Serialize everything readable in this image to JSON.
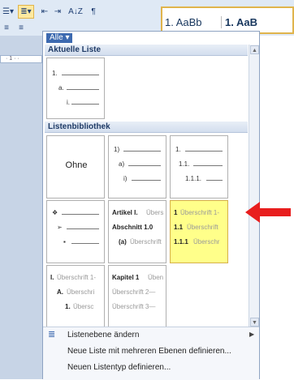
{
  "ribbon": {
    "btn_bullets": "☰▾",
    "btn_multilevel": "≣▾",
    "btn_outdent": "⇤",
    "btn_indent": "⇥",
    "btn_sort": "A↓Z",
    "btn_pilcrow": "¶",
    "btn_align_left": "≡",
    "btn_align_center": "≡",
    "style1": "1. AaBb",
    "style2": "1. AaB",
    "ruler_text": "· 1 · ·"
  },
  "panel": {
    "filter_label": "Alle ▾",
    "section_current": "Aktuelle Liste",
    "section_library": "Listenbibliothek",
    "current_list": {
      "l1": "1.",
      "l2": "a.",
      "l3": "i."
    },
    "none_label": "Ohne",
    "lib_numeric": {
      "l1": "1)",
      "l2": "a)",
      "l3": "i)"
    },
    "lib_decimal": {
      "l1": "1.",
      "l2": "1.1.",
      "l3": "1.1.1."
    },
    "lib_symbols": {
      "l1": "❖",
      "l2": "➢",
      "l3": "▪"
    },
    "lib_article": {
      "l1b": "Artikel I.",
      "l1g": "Übers",
      "l2b": "Abschnitt 1.0",
      "l3b": "(a)",
      "l3g": "Überschrift"
    },
    "lib_heading": {
      "l1b": "1",
      "l1g": "Überschrift 1-",
      "l2b": "1.1",
      "l2g": "Überschrift",
      "l3b": "1.1.1",
      "l3g": "Überschr"
    },
    "lib_roman": {
      "l1b": "I.",
      "l1g": "Überschrift 1-",
      "l2b": "A.",
      "l2g": "Überschri",
      "l3b": "1.",
      "l3g": "Übersc"
    },
    "lib_chapter": {
      "l1b": "Kapitel 1",
      "l1g": "Üben",
      "l2g": "Überschrift 2—",
      "l3g": "Überschrift 3—"
    },
    "menu": {
      "change_level": "Listenebene ändern",
      "define_multilevel": "Neue Liste mit mehreren Ebenen definieren...",
      "define_style": "Neuen Listentyp definieren..."
    },
    "scroll_up": "▲",
    "scroll_down": "▼"
  },
  "colors": {
    "selection": "#ffff8a",
    "annotation_arrow": "#e81e1e"
  },
  "icons": [
    "bullets-icon",
    "multilevel-list-icon",
    "decrease-indent-icon",
    "increase-indent-icon",
    "sort-icon",
    "pilcrow-icon",
    "align-left-icon",
    "align-center-icon",
    "list-level-icon",
    "submenu-arrow-icon",
    "red-arrow-icon"
  ]
}
